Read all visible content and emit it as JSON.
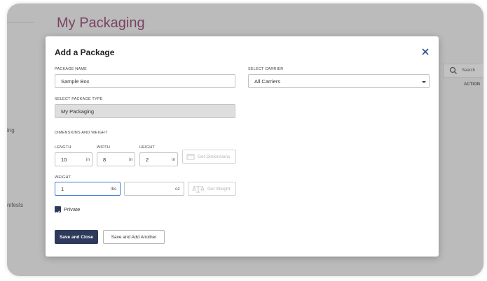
{
  "background": {
    "title": "My Packaging",
    "sidebar_items": [
      "ing",
      "nifests"
    ],
    "search_label": "Search",
    "action_header": "ACTION"
  },
  "modal": {
    "title": "Add a Package",
    "package_name": {
      "label": "PACKAGE NAME",
      "value": "Sample Box"
    },
    "carrier": {
      "label": "SELECT CARRIER",
      "value": "All Carriers"
    },
    "package_type": {
      "label": "SELECT PACKAGE TYPE",
      "value": "My Packaging"
    },
    "dimensions_section": "DIMENSIONS AND WEIGHT",
    "length": {
      "label": "LENGTH",
      "value": "10",
      "unit": "in"
    },
    "width": {
      "label": "WIDTH",
      "value": "8",
      "unit": "in"
    },
    "height": {
      "label": "HEIGHT",
      "value": "2",
      "unit": "in"
    },
    "get_dimensions": "Get Dimensions",
    "weight": {
      "label": "WEIGHT",
      "lbs_value": "1",
      "lbs_unit": "lbs",
      "oz_value": "",
      "oz_unit": "oz"
    },
    "get_weight": "Get Weight",
    "private": {
      "label": "Private",
      "checked": true
    },
    "save_close": "Save and Close",
    "save_add": "Save and Add Another"
  },
  "colors": {
    "title": "#7b1750",
    "primary": "#2e3a5c",
    "close": "#2e4f8f",
    "focus": "#3b7bd9"
  }
}
